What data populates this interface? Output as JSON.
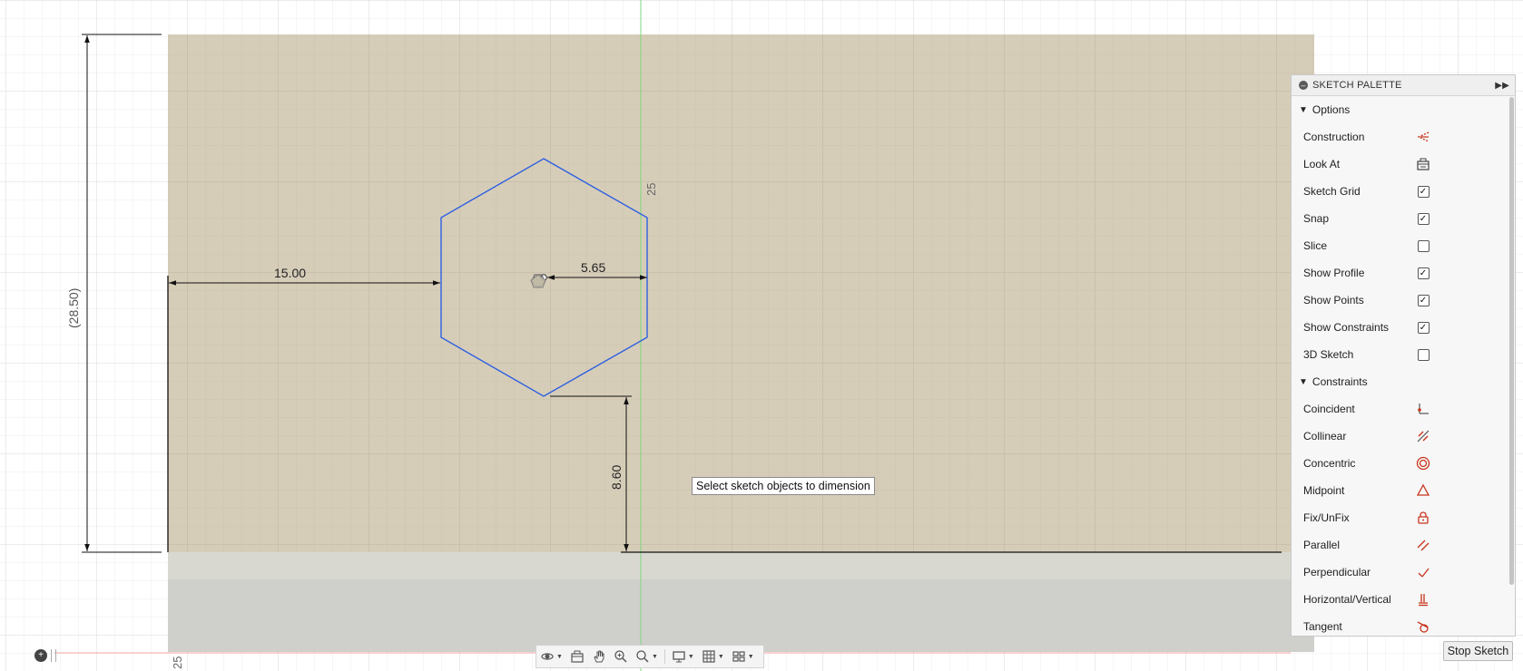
{
  "sketch": {
    "dim_width": "15.00",
    "dim_radius": "5.65",
    "dim_height": "8.60",
    "dim_ref_height": "(28.50)",
    "axis_label_top": "25",
    "axis_label_bottom": "25",
    "tooltip": "Select sketch objects to dimension"
  },
  "palette": {
    "title": "SKETCH PALETTE",
    "options_header": "Options",
    "options": [
      {
        "label": "Construction",
        "icon": "construction-icon"
      },
      {
        "label": "Look At",
        "icon": "look-at-icon"
      },
      {
        "label": "Sketch Grid",
        "checked": true
      },
      {
        "label": "Snap",
        "checked": true
      },
      {
        "label": "Slice",
        "checked": false
      },
      {
        "label": "Show Profile",
        "checked": true
      },
      {
        "label": "Show Points",
        "checked": true
      },
      {
        "label": "Show Constraints",
        "checked": true
      },
      {
        "label": "3D Sketch",
        "checked": false
      }
    ],
    "constraints_header": "Constraints",
    "constraints": [
      {
        "label": "Coincident",
        "icon": "coincident-icon"
      },
      {
        "label": "Collinear",
        "icon": "collinear-icon"
      },
      {
        "label": "Concentric",
        "icon": "concentric-icon"
      },
      {
        "label": "Midpoint",
        "icon": "midpoint-icon"
      },
      {
        "label": "Fix/UnFix",
        "icon": "lock-icon"
      },
      {
        "label": "Parallel",
        "icon": "parallel-icon"
      },
      {
        "label": "Perpendicular",
        "icon": "perpendicular-icon"
      },
      {
        "label": "Horizontal/Vertical",
        "icon": "horizontal-vertical-icon"
      },
      {
        "label": "Tangent",
        "icon": "tangent-icon"
      }
    ],
    "stop_label": "Stop Sketch"
  },
  "colors": {
    "sketch_plane": "#d6cdb9",
    "profile_line": "#2d5fe0",
    "y_axis": "#7cd87c",
    "x_axis": "#f0a0a0",
    "constraint_red": "#c8341c"
  }
}
